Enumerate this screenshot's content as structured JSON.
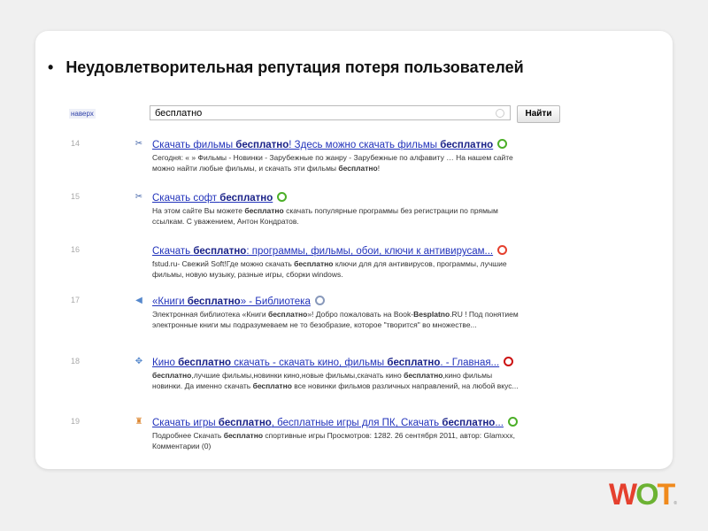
{
  "heading": {
    "bullet": "•",
    "text": "Неудовлетворительная репутация  потеря пользователей"
  },
  "top_link": "наверх",
  "search": {
    "value": "бесплатно",
    "button": "Найти"
  },
  "results": [
    {
      "num": "14",
      "icon": "scissors-icon",
      "wot_color": "#4caf28",
      "title": [
        [
          "Скачать фильмы ",
          0
        ],
        [
          "бесплатно",
          1
        ],
        [
          "! Здесь можно скачать фильмы ",
          0
        ],
        [
          "бесплатно",
          1
        ]
      ],
      "snippet": [
        [
          "Сегодня: « » Фильмы - Новинки - Зарубежные по жанру - Зарубежные по алфавиту … На нашем сайте можно найти любые фильмы, и скачать эти фильмы ",
          0
        ],
        [
          "бесплатно",
          1
        ],
        [
          "!",
          0
        ]
      ]
    },
    {
      "num": "15",
      "icon": "scissors-icon",
      "wot_color": "#4caf28",
      "title": [
        [
          "Скачать софт ",
          0
        ],
        [
          "бесплатно",
          1
        ]
      ],
      "snippet": [
        [
          "На этом сайте Вы можете ",
          0
        ],
        [
          "бесплатно",
          1
        ],
        [
          " скачать популярные программы без регистрации по прямым ссылкам. С уважением, Антон Кондратов.",
          0
        ]
      ]
    },
    {
      "num": "16",
      "icon": "none",
      "wot_color": "#e5402e",
      "title": [
        [
          "Скачать ",
          0
        ],
        [
          "бесплатно",
          1
        ],
        [
          ": программы, фильмы, обои, ключи к антивирусам...",
          0
        ]
      ],
      "snippet": [
        [
          "fstud.ru- Свежий Soft!Где можно скачать ",
          0
        ],
        [
          "бесплатно",
          1
        ],
        [
          " ключи для для антивирусов, программы, лучшие фильмы, новую музыку, разные игры, сборки windows.",
          0
        ]
      ]
    },
    {
      "num": "17",
      "icon": "arrow-left-icon",
      "wot_color": "#8899bb",
      "title": [
        [
          "«Книги ",
          0
        ],
        [
          "бесплатно",
          1
        ],
        [
          "» - Библиотека",
          0
        ]
      ],
      "snippet": [
        [
          "Электронная библиотека «Книги ",
          0
        ],
        [
          "бесплатно",
          1
        ],
        [
          "»! Добро пожаловать на Book-",
          0
        ],
        [
          "Besplatno",
          1
        ],
        [
          ".RU ! Под понятием электронные книги мы подразумеваем не то безобразие, которое \"творится\" во множестве...",
          0
        ]
      ]
    },
    {
      "num": "18",
      "icon": "gear-icon",
      "wot_color": "#cc1111",
      "title": [
        [
          "Кино ",
          0
        ],
        [
          "бесплатно",
          1
        ],
        [
          " скачать - скачать кино, фильмы ",
          0
        ],
        [
          "бесплатно",
          1
        ],
        [
          ". - Главная...",
          0
        ]
      ],
      "snippet": [
        [
          "бесплатно",
          1
        ],
        [
          ",лучшие фильмы,новинки кино,новые фильмы,скачать кино ",
          0
        ],
        [
          "бесплатно",
          1
        ],
        [
          ",кино фильмы новинки. Да именно скачать ",
          0
        ],
        [
          "бесплатно",
          1
        ],
        [
          " все новинки фильмов различных направлений, на любой вкус...",
          0
        ]
      ]
    },
    {
      "num": "19",
      "icon": "badge-icon",
      "wot_color": "#4caf28",
      "title": [
        [
          "Скачать игры ",
          0
        ],
        [
          "бесплатно",
          1
        ],
        [
          ", бесплатные игры для ПК, Скачать ",
          0
        ],
        [
          "бесплатно",
          1
        ],
        [
          "...",
          0
        ]
      ],
      "snippet": [
        [
          "Подробнее Скачать ",
          0
        ],
        [
          "бесплатно",
          1
        ],
        [
          " спортивные игры Просмотров: 1282. 26 сентября 2011, автор: Glamxxx, Комментарии (0)",
          0
        ]
      ]
    }
  ],
  "logo": {
    "text": "WOT"
  }
}
